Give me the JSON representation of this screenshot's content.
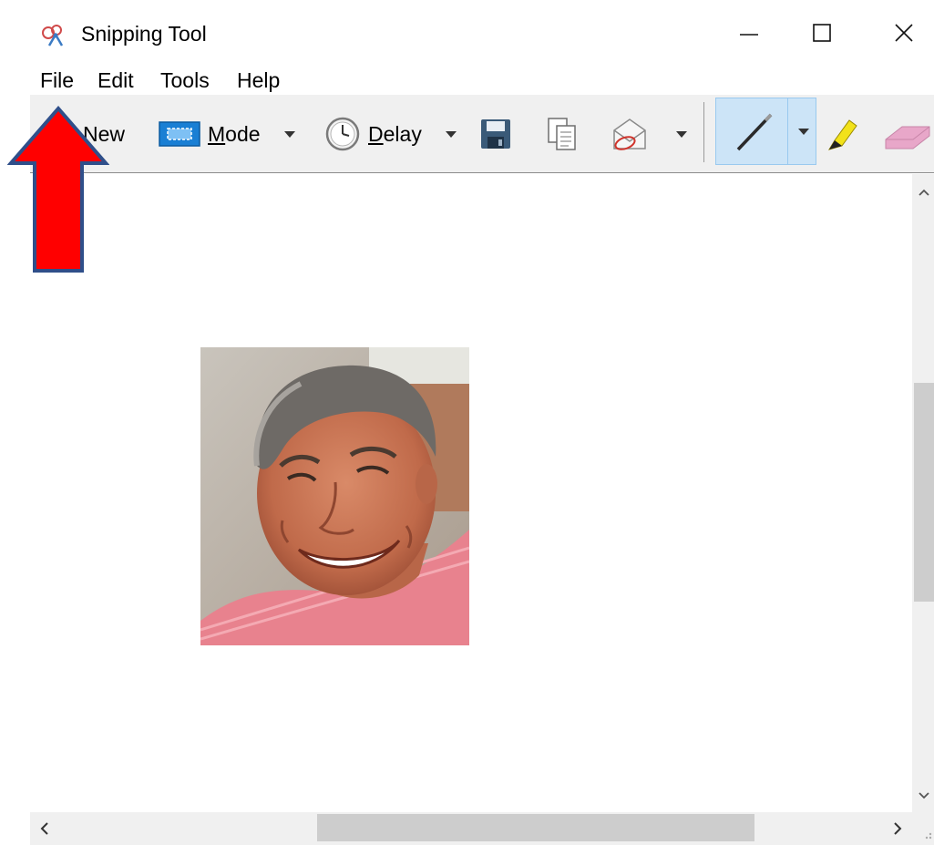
{
  "window": {
    "title": "Snipping Tool",
    "controls": {
      "minimize": "—",
      "maximize": "☐",
      "close": "✕"
    }
  },
  "menu": {
    "items": [
      {
        "label": "File"
      },
      {
        "label": "Edit"
      },
      {
        "label": "Tools"
      },
      {
        "label": "Help"
      }
    ]
  },
  "toolbar": {
    "new_label": "New",
    "mode_label_first": "M",
    "mode_label_rest": "ode",
    "delay_label_first": "D",
    "delay_label_rest": "elay",
    "icons": {
      "new": "scissors-icon",
      "mode": "mode-rectangle-icon",
      "delay": "clock-icon",
      "save": "save-icon",
      "copy": "copy-icon",
      "send": "send-email-icon",
      "pen": "pen-icon",
      "highlighter": "highlighter-icon",
      "eraser": "eraser-icon"
    }
  },
  "colors": {
    "accent_pen_selected": "#cce4f7",
    "annotation_arrow_fill": "#ff0000",
    "annotation_arrow_stroke": "#2f4f8a",
    "highlighter": "#f2e21a",
    "eraser": "#e8a7c9"
  },
  "canvas": {
    "content": "photo-of-smiling-man"
  },
  "scrollbars": {
    "vertical_up": "^",
    "vertical_down": "v",
    "horizontal_left": "<",
    "horizontal_right": ">"
  }
}
